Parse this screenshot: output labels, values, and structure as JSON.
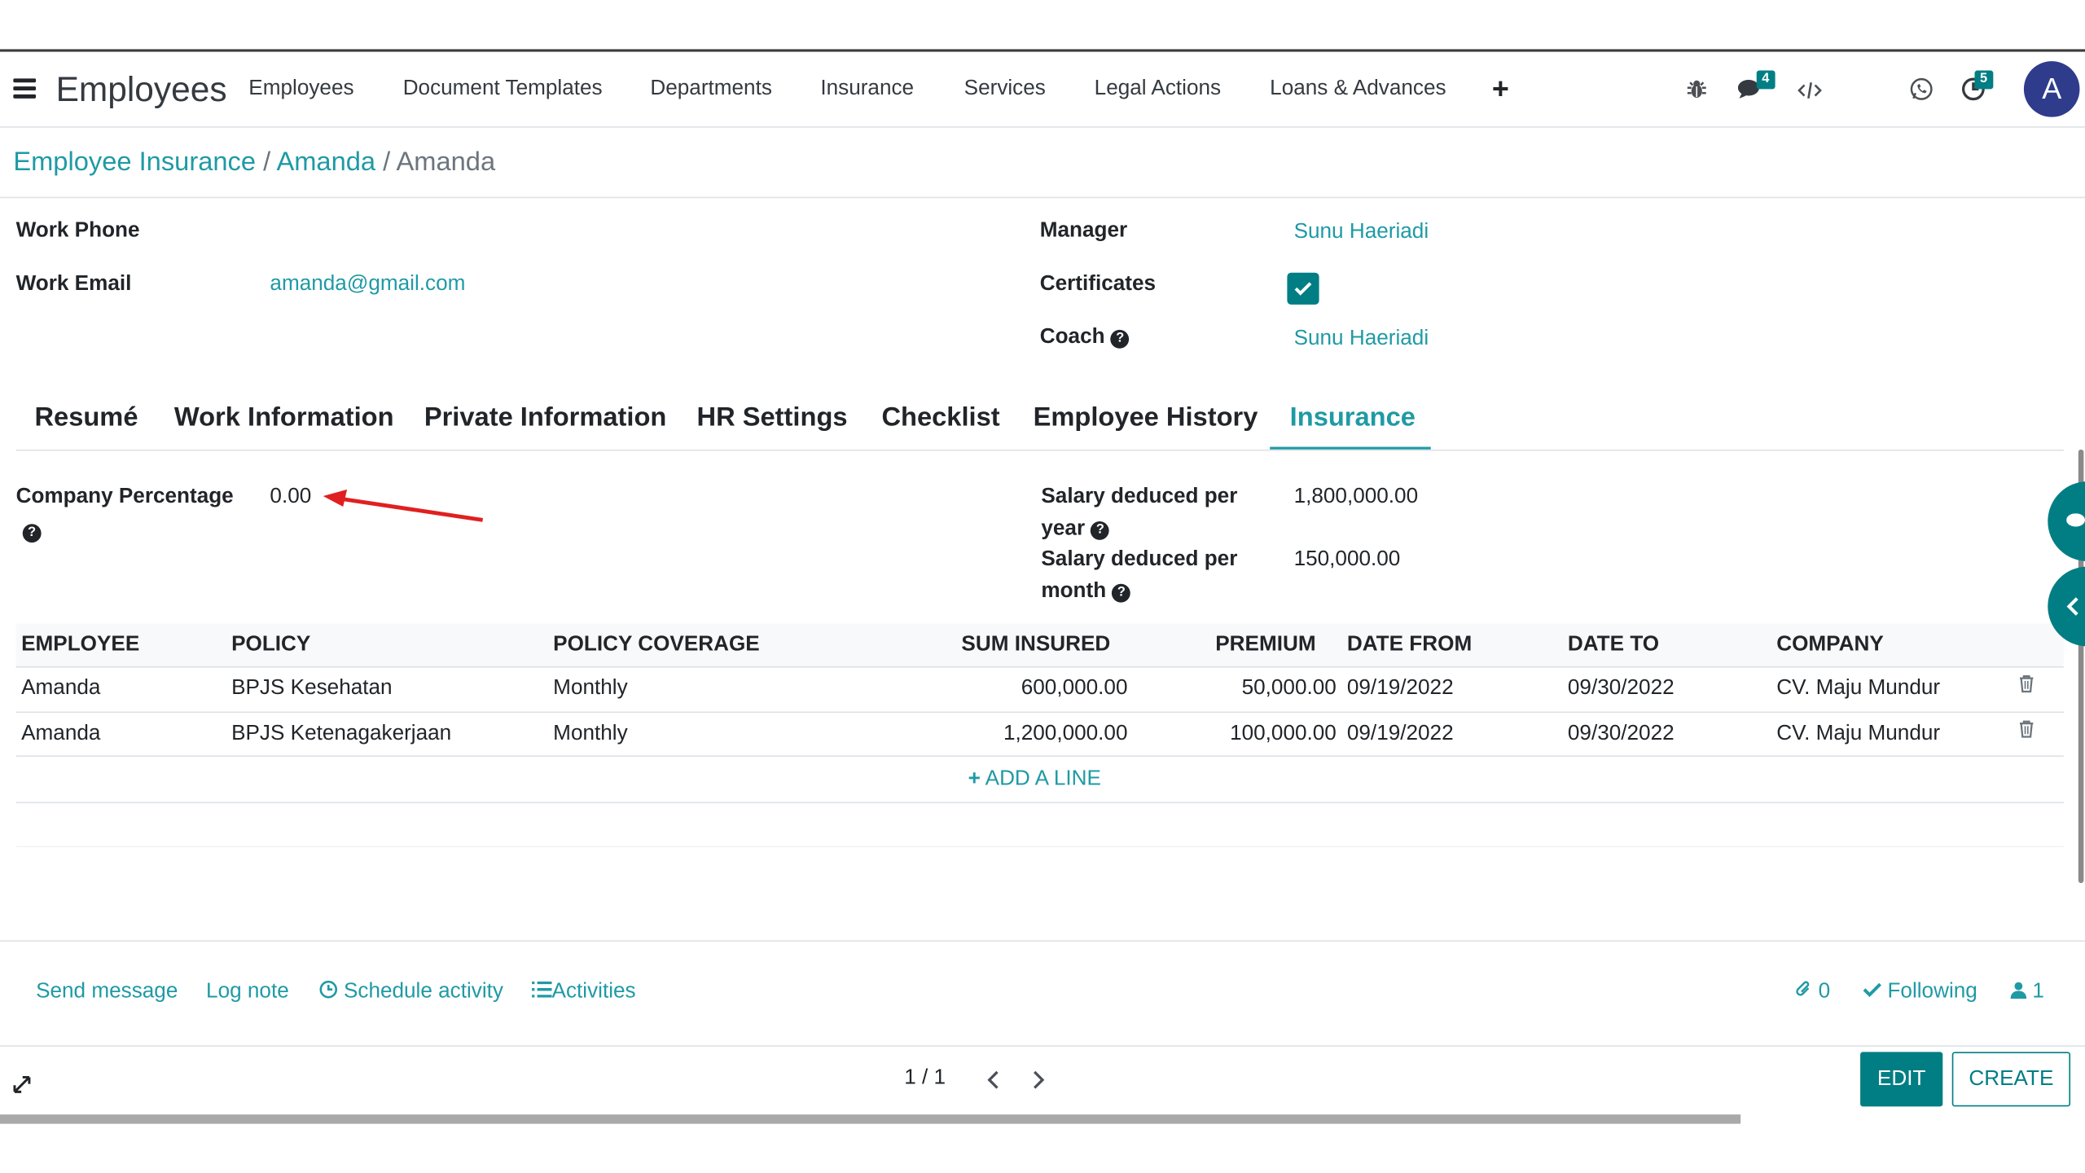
{
  "nav": {
    "app_title": "Employees",
    "menu": [
      "Employees",
      "Document Templates",
      "Departments",
      "Insurance",
      "Services",
      "Legal Actions",
      "Loans & Advances"
    ],
    "plus": "+",
    "messages_badge": "4",
    "activity_badge": "5",
    "avatar_letter": "A"
  },
  "breadcrumb": {
    "items": [
      "Employee Insurance",
      "Amanda"
    ],
    "separator": "/",
    "current": "Amanda"
  },
  "form": {
    "work_phone_label": "Work Phone",
    "work_phone_value": "",
    "work_email_label": "Work Email",
    "work_email_value": "amanda@gmail.com",
    "manager_label": "Manager",
    "manager_value": "Sunu Haeriadi",
    "certificates_label": "Certificates",
    "certificates_checked": true,
    "coach_label": "Coach",
    "coach_value": "Sunu Haeriadi"
  },
  "tabs": [
    "Resumé",
    "Work Information",
    "Private Information",
    "HR Settings",
    "Checklist",
    "Employee History",
    "Insurance"
  ],
  "active_tab": "Insurance",
  "insurance": {
    "company_percentage_label": "Company Percentage",
    "company_percentage_value": "0.00",
    "salary_year_label_1": "Salary deduced per",
    "salary_year_label_2": "year",
    "salary_year_value": "1,800,000.00",
    "salary_month_label_1": "Salary deduced per",
    "salary_month_label_2": "month",
    "salary_month_value": "150,000.00"
  },
  "table": {
    "columns": [
      "EMPLOYEE",
      "POLICY",
      "POLICY COVERAGE",
      "SUM INSURED",
      "PREMIUM",
      "DATE FROM",
      "DATE TO",
      "COMPANY"
    ],
    "rows": [
      {
        "employee": "Amanda",
        "policy": "BPJS Kesehatan",
        "coverage": "Monthly",
        "sum_insured": "600,000.00",
        "premium": "50,000.00",
        "date_from": "09/19/2022",
        "date_to": "09/30/2022",
        "company": "CV. Maju Mundur"
      },
      {
        "employee": "Amanda",
        "policy": "BPJS Ketenagakerjaan",
        "coverage": "Monthly",
        "sum_insured": "1,200,000.00",
        "premium": "100,000.00",
        "date_from": "09/19/2022",
        "date_to": "09/30/2022",
        "company": "CV. Maju Mundur"
      }
    ],
    "add_line": "ADD A LINE"
  },
  "chatter": {
    "send_message": "Send message",
    "log_note": "Log note",
    "schedule_activity": "Schedule activity",
    "activities": "Activities",
    "attachments_count": "0",
    "following": "Following",
    "followers_count": "1"
  },
  "pager": {
    "text": "1 / 1"
  },
  "buttons": {
    "edit": "EDIT",
    "create": "CREATE"
  },
  "colors": {
    "accent": "#017e84",
    "link": "#1f9aa5",
    "annotation_arrow": "#e02020"
  }
}
